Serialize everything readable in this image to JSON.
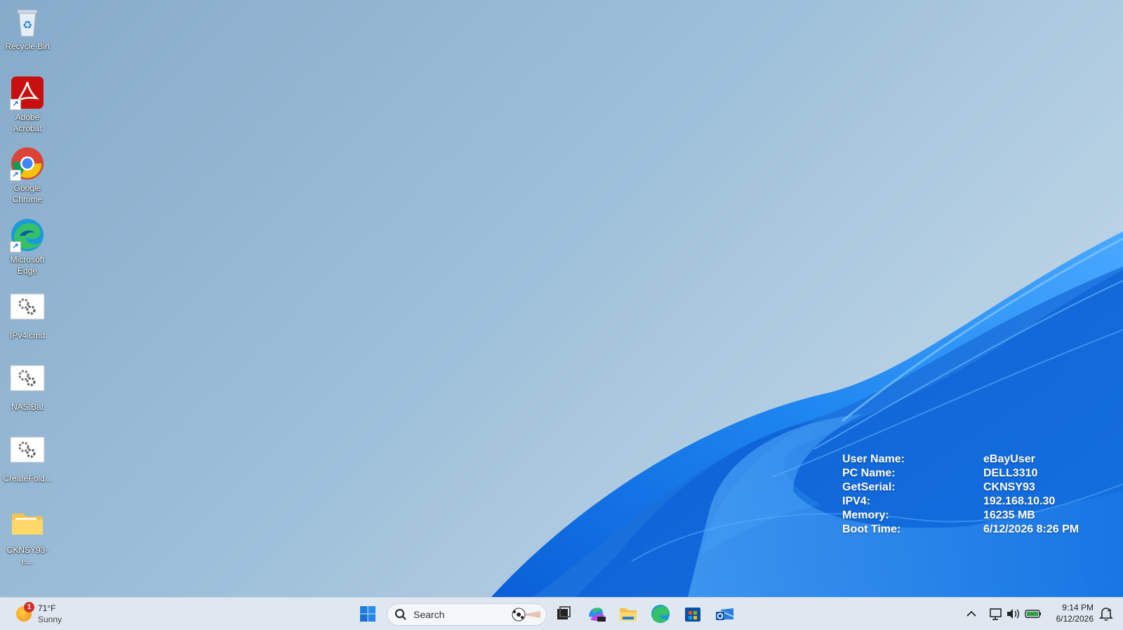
{
  "desktop": {
    "icons": [
      {
        "label": "Recycle Bin",
        "icon": "recycle-bin-icon"
      },
      {
        "label": "Adobe Acrobat",
        "icon": "adobe-acrobat-icon"
      },
      {
        "label": "Google Chrome",
        "icon": "chrome-icon"
      },
      {
        "label": "Microsoft Edge",
        "icon": "edge-icon"
      },
      {
        "label": "IPv4.cmd",
        "icon": "cmd-file-icon"
      },
      {
        "label": "NAS.Bat",
        "icon": "bat-file-icon"
      },
      {
        "label": "CreateFold...",
        "icon": "bat-file-icon"
      },
      {
        "label": "CKNSY93-e...",
        "icon": "folder-icon"
      }
    ]
  },
  "sysinfo": {
    "rows": [
      {
        "key": "User Name:",
        "value": "eBayUser"
      },
      {
        "key": "PC Name:",
        "value": "DELL3310"
      },
      {
        "key": "GetSerial:",
        "value": "CKNSY93"
      },
      {
        "key": "IPV4:",
        "value": "192.168.10.30"
      },
      {
        "key": "Memory:",
        "value": "16235 MB"
      },
      {
        "key": "Boot Time:",
        "value": "6/12/2026 8:26 PM"
      }
    ]
  },
  "taskbar": {
    "weather": {
      "badge": "1",
      "temp": "71°F",
      "condition": "Sunny"
    },
    "search": {
      "placeholder": "Search"
    },
    "pinned": [
      "start-icon",
      "task-view-icon",
      "m365-copilot-icon",
      "file-explorer-icon",
      "edge-icon",
      "microsoft-store-icon",
      "outlook-icon"
    ],
    "tray": {
      "time": "9:14 PM",
      "date": "6/12/2026"
    }
  },
  "colors": {
    "wallpaper_bg": "#9dbfd9",
    "bloom_blue": "#1a7be8",
    "taskbar_bg": "#dfe8f1"
  }
}
